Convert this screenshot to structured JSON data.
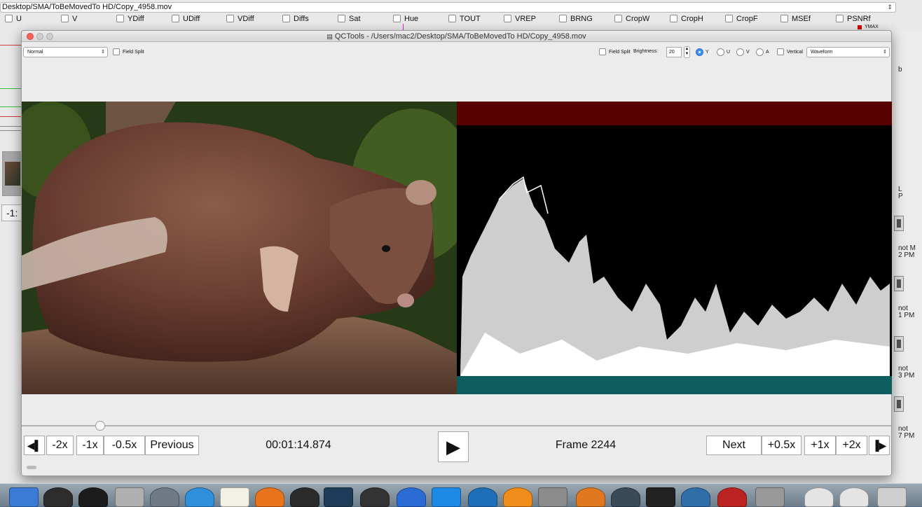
{
  "background_window": {
    "path": "Desktop/SMA/ToBeMovedTo HD/Copy_4958.mov",
    "filters": [
      {
        "label": "U"
      },
      {
        "label": "V"
      },
      {
        "label": "YDiff"
      },
      {
        "label": "UDiff"
      },
      {
        "label": "VDiff"
      },
      {
        "label": "Diffs"
      },
      {
        "label": "Sat"
      },
      {
        "label": "Hue"
      },
      {
        "label": "TOUT"
      },
      {
        "label": "VREP"
      },
      {
        "label": "BRNG"
      },
      {
        "label": "CropW"
      },
      {
        "label": "CropH"
      },
      {
        "label": "CropF"
      },
      {
        "label": "MSEf"
      },
      {
        "label": "PSNRf"
      }
    ],
    "legend_label": "YMAX",
    "legend_color": "#d40000",
    "speed_text": "-1:",
    "side_captions": [
      {
        "label": "b"
      },
      {
        "label": "L\nP"
      },
      {
        "label": "not M\n2 PM"
      },
      {
        "label": "not\n1 PM"
      },
      {
        "label": "not\n3 PM"
      },
      {
        "label": "not\n7 PM"
      }
    ]
  },
  "window": {
    "title": "QCTools - /Users/mac2/Desktop/SMA/ToBeMovedTo HD/Copy_4958.mov"
  },
  "toolbar": {
    "view_mode": "Normal",
    "field_split_label": "Field Split",
    "right_field_split_label": "Field Split",
    "brightness_label": "Brightness:",
    "brightness_value": "20",
    "channels": [
      {
        "label": "Y",
        "selected": true
      },
      {
        "label": "U",
        "selected": false
      },
      {
        "label": "V",
        "selected": false
      },
      {
        "label": "A",
        "selected": false
      }
    ],
    "vertical_label": "Vertical",
    "scope_mode": "Waveform"
  },
  "playback": {
    "timecode": "00:01:14.874",
    "frame_label": "Frame 2244",
    "position_fraction": 0.09,
    "buttons": {
      "first": "◀▌",
      "minus2": "-2x",
      "minus1": "-1x",
      "minus05": "-0.5x",
      "previous": "Previous",
      "next": "Next",
      "plus05": "+0.5x",
      "plus1": "+1x",
      "plus2": "+2x",
      "last": "▐▶"
    }
  },
  "colors": {
    "scope_top": "#560000",
    "scope_bottom": "#0d5d5e",
    "radio_selected": "#3d8ef7"
  },
  "dock": {
    "icons": [
      "finder-icon",
      "activity-monitor-icon",
      "terminal-icon",
      "printer-icon",
      "launchpad-icon",
      "safari-icon",
      "textedit-icon",
      "firefox-icon",
      "qctools-icon",
      "app-window-icon",
      "final-cut-icon",
      "quicktime-icon",
      "quicktime-x-icon",
      "app-store-icon",
      "vlc-icon",
      "system-preferences-icon",
      "person-icon",
      "disk-utility-icon",
      "dvd-player-icon",
      "image-capture-icon",
      "photo-booth-icon",
      "utility-icon",
      "downloads-stack-icon",
      "documents-stack-icon",
      "trash-icon"
    ]
  }
}
